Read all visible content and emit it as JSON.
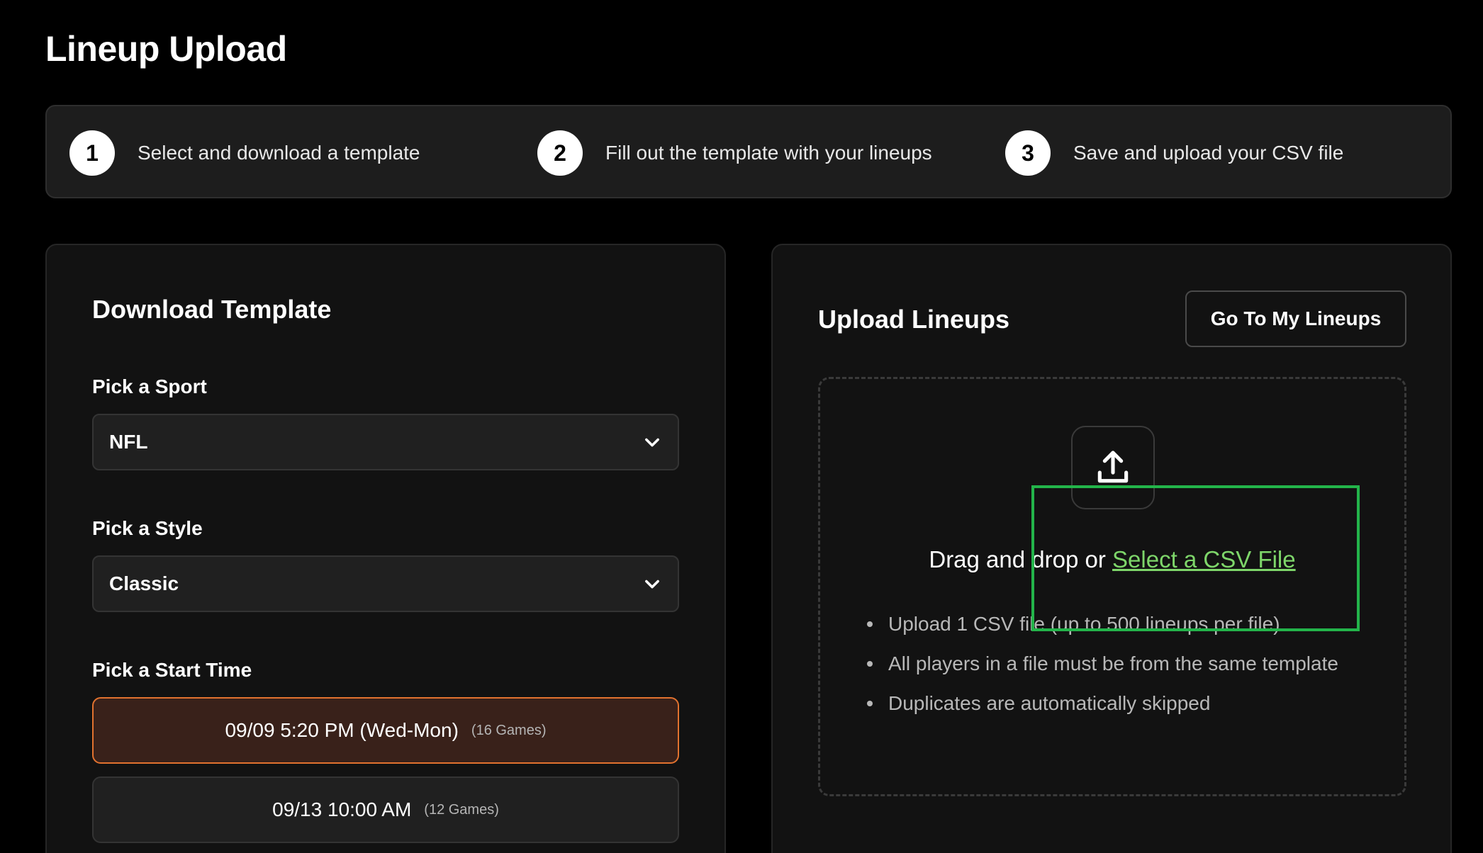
{
  "page": {
    "title": "Lineup Upload"
  },
  "steps": [
    {
      "number": "1",
      "text": "Select and download a template"
    },
    {
      "number": "2",
      "text": "Fill out the template with your lineups"
    },
    {
      "number": "3",
      "text": "Save and upload your CSV file"
    }
  ],
  "download": {
    "title": "Download Template",
    "sport": {
      "label": "Pick a Sport",
      "value": "NFL"
    },
    "style": {
      "label": "Pick a Style",
      "value": "Classic"
    },
    "start_time": {
      "label": "Pick a Start Time",
      "options": [
        {
          "label": "09/09 5:20 PM (Wed-Mon)",
          "games": "(16 Games)",
          "selected": true
        },
        {
          "label": "09/13 10:00 AM",
          "games": "(12 Games)",
          "selected": false
        }
      ]
    }
  },
  "upload": {
    "title": "Upload Lineups",
    "go_button": "Go To My Lineups",
    "drag_text": "Drag and drop or",
    "link_text": "Select a CSV File",
    "rules": [
      "Upload 1 CSV file (up to 500 lineups per file)",
      "All players in a file must be from the same template",
      "Duplicates are automatically skipped"
    ]
  },
  "colors": {
    "background": "#000000",
    "card": "#121212",
    "accent_orange": "#e2722f",
    "link_green": "#7ed66a",
    "highlight_green": "#23b44a"
  },
  "icons": {
    "upload": "upload-icon",
    "select_chevron": "chevron-down-icon"
  }
}
